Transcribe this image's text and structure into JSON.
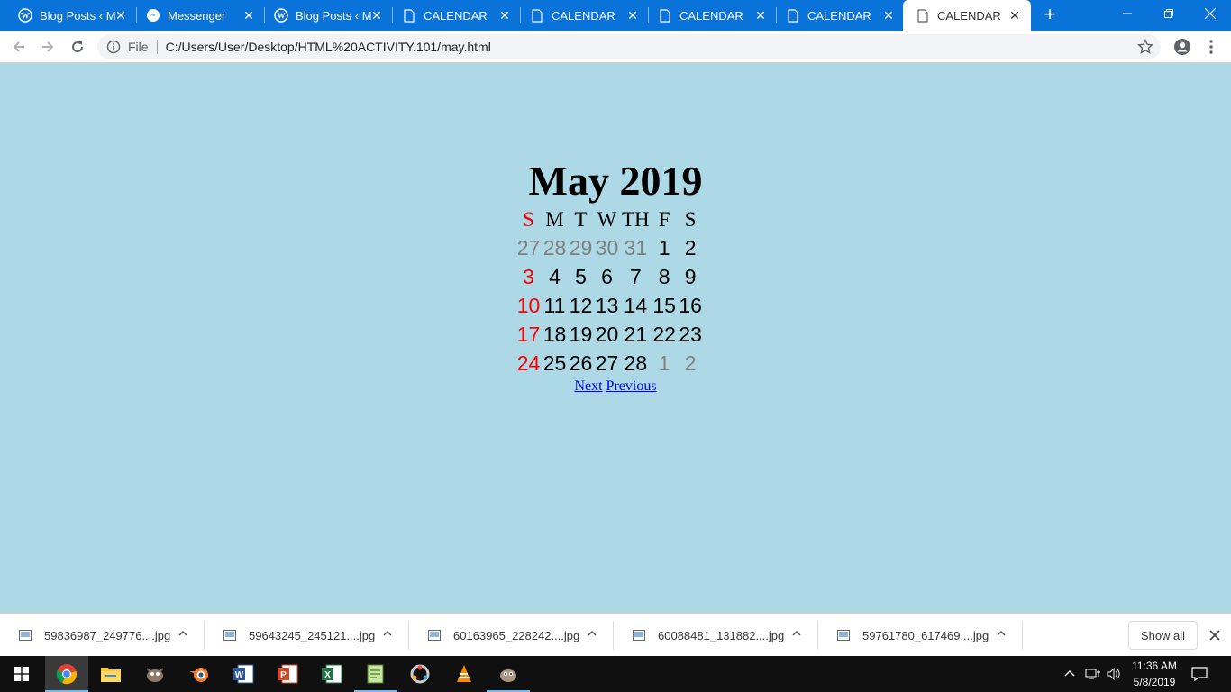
{
  "browser": {
    "tabs": [
      {
        "label": "Blog Posts ‹ M",
        "icon": "wordpress-icon",
        "active": false
      },
      {
        "label": "Messenger",
        "icon": "messenger-icon",
        "active": false
      },
      {
        "label": "Blog Posts ‹ M",
        "icon": "wordpress-icon",
        "active": false
      },
      {
        "label": "CALENDAR",
        "icon": "document-icon",
        "active": false
      },
      {
        "label": "CALENDAR",
        "icon": "document-icon",
        "active": false
      },
      {
        "label": "CALENDAR",
        "icon": "document-icon",
        "active": false
      },
      {
        "label": "CALENDAR",
        "icon": "document-icon",
        "active": false
      },
      {
        "label": "CALENDAR",
        "icon": "document-icon",
        "active": true
      }
    ],
    "address": {
      "scheme_label": "File",
      "url": "C:/Users/User/Desktop/HTML%20ACTIVITY.101/may.html"
    },
    "colors": {
      "tabstrip": "#0a73d9",
      "page_bg": "#add8e6"
    }
  },
  "calendar": {
    "title": "May 2019",
    "headers": [
      "S",
      "M",
      "T",
      "W",
      "TH",
      "F",
      "S"
    ],
    "weeks": [
      [
        {
          "d": "27",
          "c": "gray"
        },
        {
          "d": "28",
          "c": "gray"
        },
        {
          "d": "29",
          "c": "gray"
        },
        {
          "d": "30",
          "c": "gray"
        },
        {
          "d": "31",
          "c": "gray"
        },
        {
          "d": "1",
          "c": "blk"
        },
        {
          "d": "2",
          "c": "blk"
        }
      ],
      [
        {
          "d": "3",
          "c": "red"
        },
        {
          "d": "4",
          "c": "blk"
        },
        {
          "d": "5",
          "c": "blk"
        },
        {
          "d": "6",
          "c": "blk"
        },
        {
          "d": "7",
          "c": "blk"
        },
        {
          "d": "8",
          "c": "blk"
        },
        {
          "d": "9",
          "c": "blk"
        }
      ],
      [
        {
          "d": "10",
          "c": "red"
        },
        {
          "d": "11",
          "c": "blk"
        },
        {
          "d": "12",
          "c": "blk"
        },
        {
          "d": "13",
          "c": "blk"
        },
        {
          "d": "14",
          "c": "blk"
        },
        {
          "d": "15",
          "c": "blk"
        },
        {
          "d": "16",
          "c": "blk"
        }
      ],
      [
        {
          "d": "17",
          "c": "red"
        },
        {
          "d": "18",
          "c": "blk"
        },
        {
          "d": "19",
          "c": "blk"
        },
        {
          "d": "20",
          "c": "blk"
        },
        {
          "d": "21",
          "c": "blk"
        },
        {
          "d": "22",
          "c": "blk"
        },
        {
          "d": "23",
          "c": "blk"
        }
      ],
      [
        {
          "d": "24",
          "c": "red"
        },
        {
          "d": "25",
          "c": "blk"
        },
        {
          "d": "26",
          "c": "blk"
        },
        {
          "d": "27",
          "c": "blk"
        },
        {
          "d": "28",
          "c": "blk"
        },
        {
          "d": "1",
          "c": "gray"
        },
        {
          "d": "2",
          "c": "gray"
        }
      ]
    ],
    "links": {
      "next": "Next",
      "previous": "Previous"
    },
    "colors": {
      "sunday": "#ff0000",
      "other_month": "#808080"
    }
  },
  "downloads": {
    "items": [
      {
        "name": "59836987_249776....jpg"
      },
      {
        "name": "59643245_245121....jpg"
      },
      {
        "name": "60163965_228242....jpg"
      },
      {
        "name": "60088481_131882....jpg"
      },
      {
        "name": "59761780_617469....jpg"
      }
    ],
    "show_all": "Show all"
  },
  "taskbar": {
    "apps": [
      "chrome-icon",
      "file-explorer-icon",
      "gimp-icon",
      "blender-icon",
      "word-icon",
      "powerpoint-icon",
      "excel-icon",
      "notepad-plus-icon",
      "davinci-icon",
      "vlc-icon",
      "gimp-wilber-icon"
    ],
    "time": "11:36 AM",
    "date": "5/8/2019"
  }
}
